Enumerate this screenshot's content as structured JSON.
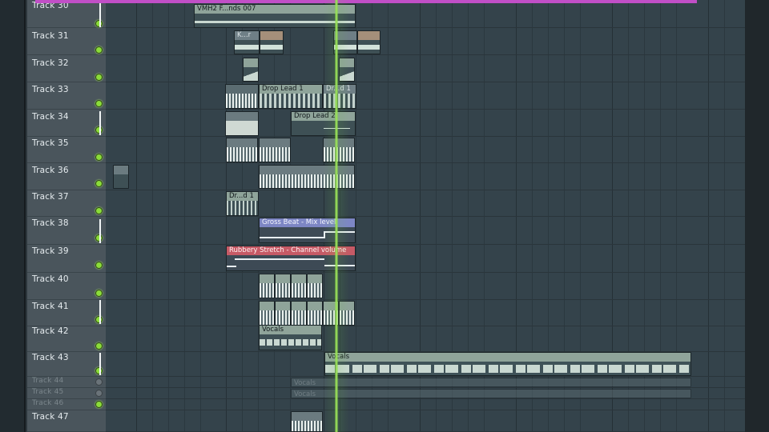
{
  "tracks": [
    {
      "name": "Track 30",
      "led": "on"
    },
    {
      "name": "Track 31",
      "led": "on"
    },
    {
      "name": "Track 32",
      "led": "on"
    },
    {
      "name": "Track 33",
      "led": "on"
    },
    {
      "name": "Track 34",
      "led": "on"
    },
    {
      "name": "Track 35",
      "led": "on"
    },
    {
      "name": "Track 36",
      "led": "on"
    },
    {
      "name": "Track 37",
      "led": "on"
    },
    {
      "name": "Track 38",
      "led": "on"
    },
    {
      "name": "Track 39",
      "led": "on"
    },
    {
      "name": "Track 40",
      "led": "on"
    },
    {
      "name": "Track 41",
      "led": "on"
    },
    {
      "name": "Track 42",
      "led": "on"
    },
    {
      "name": "Track 43",
      "led": "on"
    },
    {
      "name": "Track 44",
      "led": "off"
    },
    {
      "name": "Track 45",
      "led": "off"
    },
    {
      "name": "Track 46",
      "led": "on"
    },
    {
      "name": "Track 47",
      "led": "on"
    }
  ],
  "clips": {
    "vmh2": "VMH2 F...nds 007",
    "track31_a": "K...r",
    "track31_b": "",
    "track31_c": "",
    "track31_d": "",
    "track32_a": "",
    "track32_b": "",
    "drop_lead_1": "Drop Lead 1",
    "dr_d1_b": "Dr...d 1",
    "drop_lead_2": "Drop Lead 2",
    "dr_d1": "Dr...d 1",
    "gross_beat": "Gross Beat - Mix level",
    "rubbery": "Rubbery Stretch - Channel volume",
    "vocals_42": "Vocals",
    "vocals_43": "Vocals",
    "vocals_44": "Vocals",
    "vocals_45": "Vocals"
  },
  "colors": {
    "playhead": "#9be05a",
    "led_on": "#8bdc3a",
    "automation_blue": "#7d86c4",
    "automation_red": "#c65a66",
    "clip_title": "#8fa49a",
    "top_marker": "#c14fc7"
  }
}
